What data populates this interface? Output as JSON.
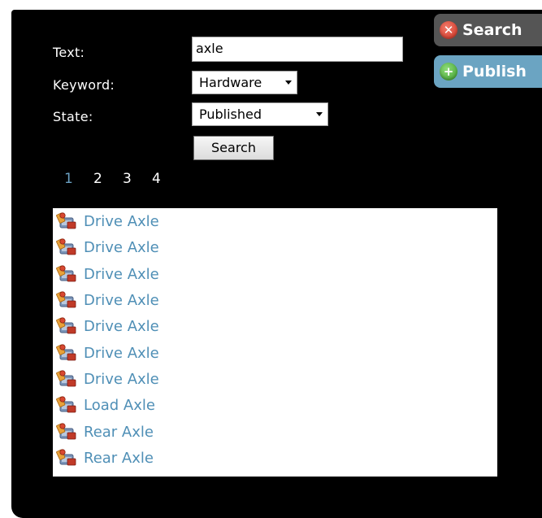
{
  "form": {
    "text_label": "Text:",
    "text_value": "axle",
    "keyword_label": "Keyword:",
    "keyword_value": "Hardware",
    "state_label": "State:",
    "state_value": "Published",
    "search_button": "Search"
  },
  "side_buttons": {
    "search": {
      "label": "Search",
      "icon": "x-circle-icon",
      "color": "#555555",
      "icon_color": "#d9432f"
    },
    "publish": {
      "label": "Publish",
      "icon": "plus-circle-icon",
      "color": "#6ba4c2",
      "icon_color": "#4caf3a"
    }
  },
  "pagination": {
    "pages": [
      "1",
      "2",
      "3",
      "4"
    ],
    "current": "1",
    "current_color": "#6a9fc0"
  },
  "results": [
    {
      "label": "Drive Axle",
      "icon": "hardware-item-icon"
    },
    {
      "label": "Drive Axle",
      "icon": "hardware-item-icon"
    },
    {
      "label": "Drive Axle",
      "icon": "hardware-item-icon"
    },
    {
      "label": "Drive Axle",
      "icon": "hardware-item-icon"
    },
    {
      "label": "Drive Axle",
      "icon": "hardware-item-icon"
    },
    {
      "label": "Drive Axle",
      "icon": "hardware-item-icon"
    },
    {
      "label": "Drive Axle",
      "icon": "hardware-item-icon"
    },
    {
      "label": "Load Axle",
      "icon": "hardware-item-icon"
    },
    {
      "label": "Rear Axle",
      "icon": "hardware-item-icon"
    },
    {
      "label": "Rear Axle",
      "icon": "hardware-item-icon"
    }
  ],
  "colors": {
    "panel_background": "#000000",
    "link": "#4f8fb6"
  }
}
